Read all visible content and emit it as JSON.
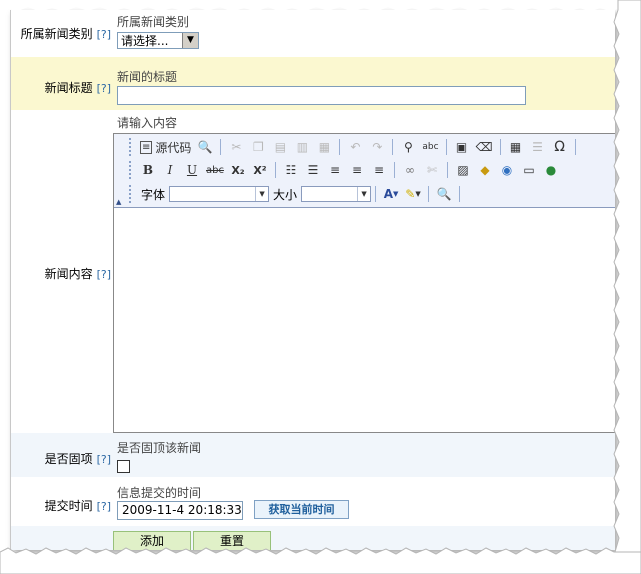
{
  "form": {
    "category": {
      "label": "所属新闻类别",
      "help": "[?]",
      "hint": "所属新闻类别",
      "select_value": "请选择..."
    },
    "title": {
      "label": "新闻标题",
      "help": "[?]",
      "hint": "新闻的标题",
      "value": ""
    },
    "content": {
      "label": "新闻内容",
      "help": "[?]",
      "hint": "请输入内容"
    },
    "top": {
      "label": "是否固项",
      "help": "[?]",
      "hint": "是否固顶该新闻",
      "checked": false
    },
    "time": {
      "label": "提交时间",
      "help": "[?]",
      "hint": "信息提交的时间",
      "value": "2009-11-4 20:18:33",
      "get_time_label": "获取当前时间"
    },
    "buttons": {
      "add_label": "添加",
      "reset_label": "重置"
    }
  },
  "editor": {
    "toolbar": {
      "source_label": "源代码",
      "font_label": "字体",
      "size_label": "大小",
      "bold": "B",
      "italic": "I",
      "underline": "U",
      "strike": "abc",
      "subscript": "X₂",
      "superscript": "X²",
      "omega": "Ω",
      "font_color": "A",
      "spell": "abc"
    },
    "icons": [
      "source-icon",
      "preview-icon",
      "cut-icon",
      "copy-icon",
      "paste-icon",
      "paste-text-icon",
      "paste-word-icon",
      "undo-icon",
      "redo-icon",
      "find-icon",
      "replace-icon",
      "select-all-icon",
      "eraser-icon",
      "table-icon",
      "horizontal-rule-icon",
      "special-char-icon",
      "ordered-list-icon",
      "unordered-list-icon",
      "align-left-icon",
      "align-center-icon",
      "align-right-icon",
      "link-icon",
      "unlink-icon",
      "image-icon",
      "flash-icon",
      "media-icon",
      "iframe-icon",
      "globe-icon",
      "font-color-icon",
      "highlight-icon",
      "find-preview-icon"
    ]
  },
  "colors": {
    "title_row_bg": "#fbf8d0",
    "alt_row_bg": "#f1f6fb",
    "help_link": "#2f6aa5",
    "button_bg": "#e0f0c8",
    "toolbar_bg": "#eef2fb"
  }
}
